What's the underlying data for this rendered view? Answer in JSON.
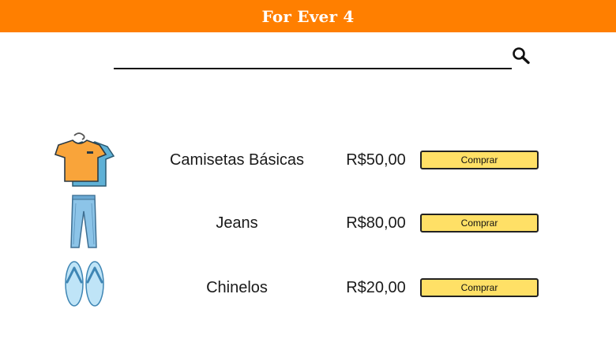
{
  "header": {
    "title": "For Ever 4",
    "background": "#ff7f00"
  },
  "search": {
    "value": "",
    "placeholder": "",
    "icon": "search-icon"
  },
  "products": [
    {
      "name": "Camisetas Básicas",
      "price": "R$50,00",
      "button_label": "Comprar",
      "image": "tshirt-image"
    },
    {
      "name": "Jeans",
      "price": "R$80,00",
      "button_label": "Comprar",
      "image": "jeans-image"
    },
    {
      "name": "Chinelos",
      "price": "R$20,00",
      "button_label": "Comprar",
      "image": "flip-flops-image"
    }
  ],
  "colors": {
    "button": "#ffe066",
    "accent": "#ff7f00"
  }
}
